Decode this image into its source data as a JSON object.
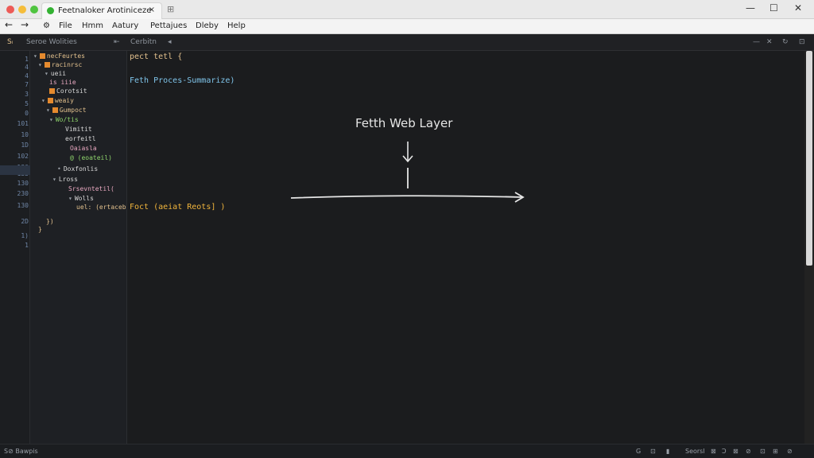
{
  "window": {
    "tab_title": "Feetnaloker Arotiniceze",
    "tab_close": "×",
    "newtab": "⊞",
    "controls": [
      "—",
      "☐",
      "✕"
    ]
  },
  "menu": {
    "back": "←",
    "forward": "→",
    "settings": "⚙",
    "items": [
      "File",
      "Hmm",
      "Aatury",
      "Pettajues",
      "Dleby",
      "Help"
    ]
  },
  "sidebar": {
    "toggle_label": "Sᵢ",
    "header": "Seroe Wolities",
    "header_icon": "⇤",
    "editor_tab": "Cerbitn",
    "editor_tab_icon": "◂"
  },
  "line_numbers": [
    "1",
    "4",
    "4",
    "7",
    "3",
    "5",
    "0",
    "101",
    "10",
    "1D",
    "102",
    "130",
    "133",
    "130",
    "230",
    "130",
    "2D",
    "1)",
    "1"
  ],
  "tree": [
    {
      "caret": "▾",
      "icon": true,
      "text": "necFeurtes",
      "color": "#e2c08d"
    },
    {
      "caret": "▾",
      "icon": true,
      "text": "racinrsc",
      "color": "#e2c08d"
    },
    {
      "caret": "▾",
      "icon": false,
      "text": "ueii",
      "color": "#d7d7d7"
    },
    {
      "caret": "",
      "icon": false,
      "text": "is iiie",
      "color": "#e8a8c0"
    },
    {
      "caret": "",
      "icon": true,
      "text": "Corotsit",
      "color": "#d7d7d7"
    },
    {
      "caret": "▾",
      "icon": true,
      "text": "weaiy",
      "color": "#e2c08d"
    },
    {
      "caret": "▾",
      "icon": true,
      "text": "Gumpoct",
      "color": "#e2c08d"
    },
    {
      "caret": "▾",
      "icon": false,
      "text": "Wo/tis",
      "color": "#8ed36b"
    },
    {
      "caret": "",
      "icon": false,
      "text": "Vimitit",
      "color": "#d7d7d7"
    },
    {
      "caret": "",
      "icon": false,
      "text": "eorfeitl",
      "color": "#d7d7d7"
    },
    {
      "caret": "",
      "icon": false,
      "text": "Oaiasla",
      "color": "#e8a8c0"
    },
    {
      "caret": "",
      "icon": false,
      "text": "@ (eoateil)",
      "color": "#8ed36b"
    },
    {
      "caret": "•",
      "icon": false,
      "text": "Doxfonlis",
      "color": "#d7d7d7"
    },
    {
      "caret": "▾",
      "icon": false,
      "text": "Lross",
      "color": "#d7d7d7"
    },
    {
      "caret": "",
      "icon": false,
      "text": "Srsevntetil(",
      "color": "#e8a8c0"
    },
    {
      "caret": "▾",
      "icon": false,
      "text": "Wolls",
      "color": "#d7d7d7"
    },
    {
      "caret": "",
      "icon": false,
      "text": "uel: (ertacebo",
      "color": "#e2c08d"
    },
    {
      "caret": "",
      "icon": false,
      "text": "})",
      "color": "#e2c08d"
    },
    {
      "caret": "",
      "icon": false,
      "text": "}",
      "color": "#e2c08d"
    }
  ],
  "code": {
    "line1": "pect tetl {",
    "line2": "Feth Proces-Summarize)",
    "line3": "Foct (aeiat Reots] )"
  },
  "canvas": {
    "title": "Fetth Web Layer"
  },
  "status": {
    "left": "S⊘ Bawpis",
    "right_items": [
      "G",
      "⊡",
      "▮",
      "Seorsl",
      "⊠",
      "Ͻ",
      "⊠",
      "⊘",
      "⊡",
      "⊞",
      "⊘"
    ]
  }
}
